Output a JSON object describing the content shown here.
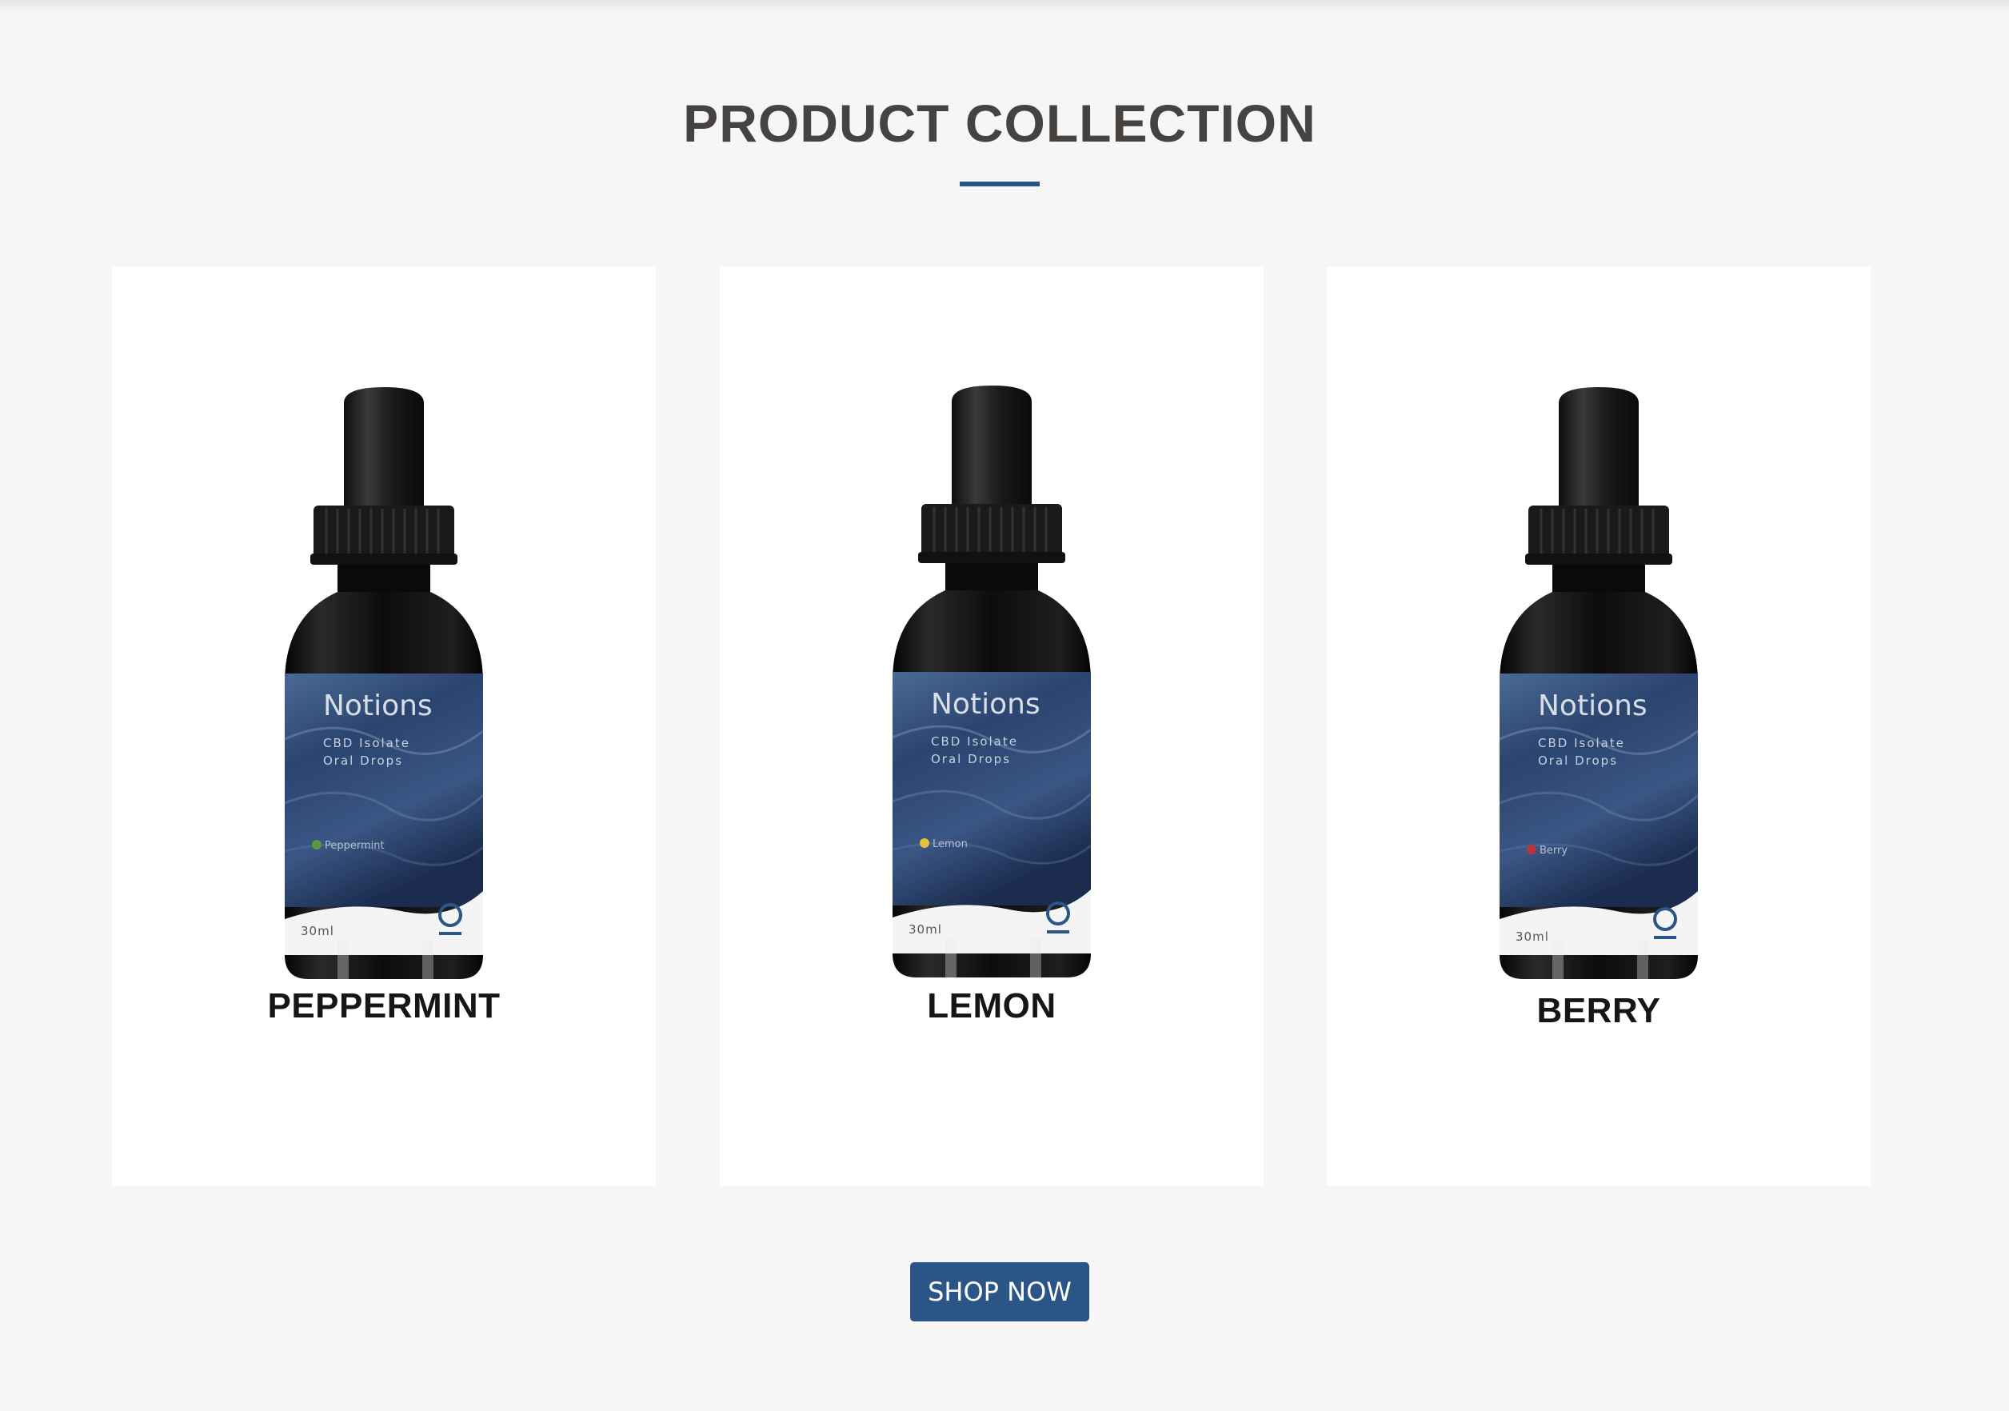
{
  "section": {
    "title": "PRODUCT COLLECTION"
  },
  "colors": {
    "accent": "#2c5587",
    "background": "#f6f6f6",
    "card": "#ffffff",
    "title_text": "#454240"
  },
  "products": [
    {
      "name": "PEPPERMINT",
      "brand": "Notions",
      "line1": "CBD Isolate",
      "line2": "Oral Drops",
      "flavor_label": "Peppermint",
      "volume": "30ml",
      "flavor_icon": "mint-leaf-icon",
      "flavor_color": "#5a9a3a"
    },
    {
      "name": "LEMON",
      "brand": "Notions",
      "line1": "CBD Isolate",
      "line2": "Oral Drops",
      "flavor_label": "Lemon",
      "volume": "30ml",
      "flavor_icon": "lemon-icon",
      "flavor_color": "#e6c13a"
    },
    {
      "name": "BERRY",
      "brand": "Notions",
      "line1": "CBD Isolate",
      "line2": "Oral Drops",
      "flavor_label": "Berry",
      "volume": "30ml",
      "flavor_icon": "berry-icon",
      "flavor_color": "#b8363a"
    }
  ],
  "cta": {
    "label": "SHOP NOW"
  }
}
